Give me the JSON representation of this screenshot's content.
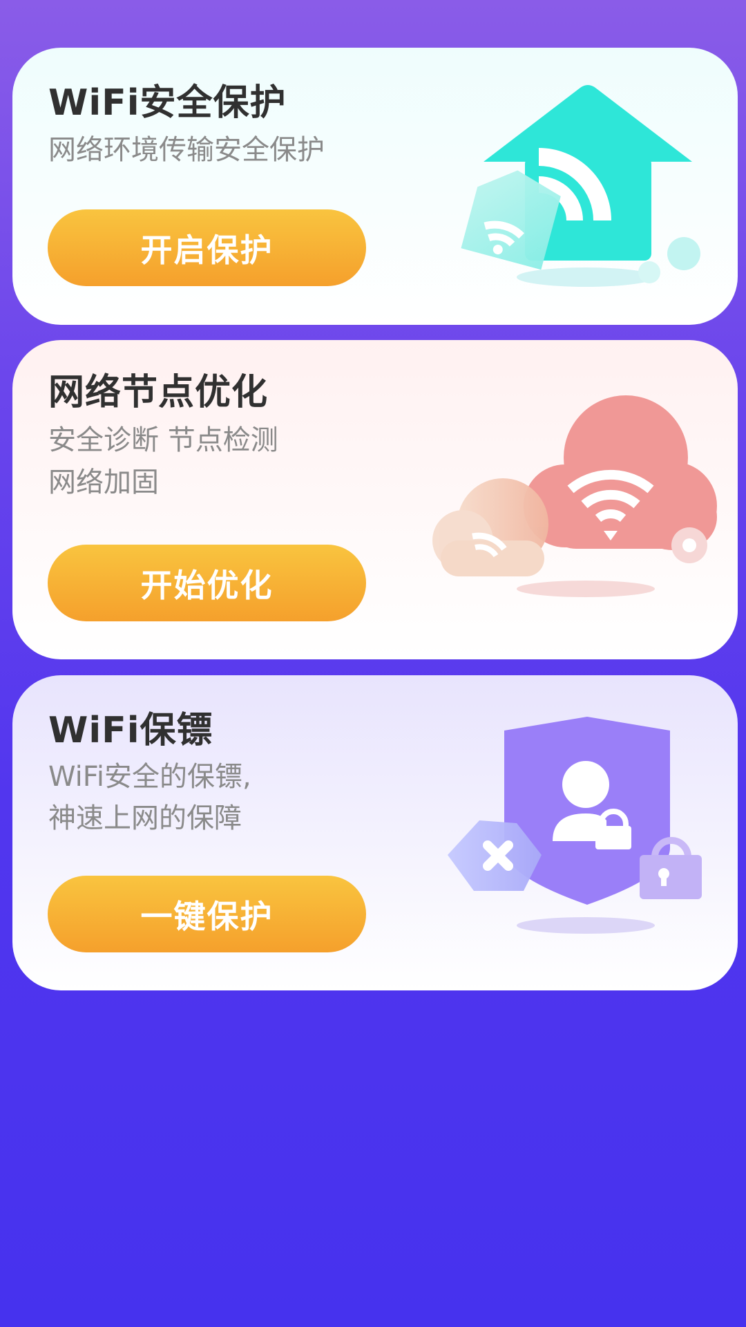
{
  "cards": [
    {
      "title": "WiFi安全保护",
      "subtitle_lines": [
        "网络环境传输安全保护"
      ],
      "button_label": "开启保护",
      "illustration": "house-wifi-icon",
      "accent": "#2ee6d8"
    },
    {
      "title": "网络节点优化",
      "subtitle_lines": [
        "安全诊断    节点检测",
        "网络加固"
      ],
      "button_label": "开始优化",
      "illustration": "cloud-wifi-icon",
      "accent": "#f09896"
    },
    {
      "title": "WiFi保镖",
      "subtitle_lines": [
        "WiFi安全的保镖,",
        "神速上网的保障"
      ],
      "button_label": "一键保护",
      "illustration": "shield-user-lock-icon",
      "accent": "#9a7ff8"
    }
  ],
  "colors": {
    "background_top": "#8a5ce8",
    "background_bottom": "#4632ee",
    "button_top": "#f9c43f",
    "button_bottom": "#f5a02c"
  }
}
